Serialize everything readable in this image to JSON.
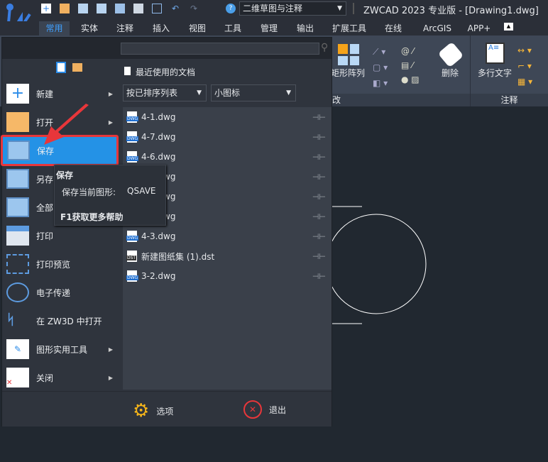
{
  "app": {
    "title": "ZWCAD 2023 专业版 - [Drawing1.dwg]",
    "workspace": "二维草图与注释"
  },
  "quick_access": [
    "new-icon",
    "open-icon",
    "save-icon",
    "save-as-icon",
    "copy-icon",
    "print-icon",
    "preview-icon",
    "undo-icon",
    "redo-icon",
    "help-icon"
  ],
  "tabs": [
    {
      "label": "常用",
      "active": true
    },
    {
      "label": "实体"
    },
    {
      "label": "注释"
    },
    {
      "label": "插入"
    },
    {
      "label": "视图"
    },
    {
      "label": "工具"
    },
    {
      "label": "管理"
    },
    {
      "label": "输出"
    },
    {
      "label": "扩展工具"
    },
    {
      "label": "在线"
    },
    {
      "label": "ArcGIS"
    },
    {
      "label": "APP+"
    }
  ],
  "ribbon": {
    "array_label": "矩形阵列",
    "delete_label": "删除",
    "mtext_label": "多行文字",
    "modify_panel": "改",
    "annotate_panel": "注释"
  },
  "menu": {
    "items": [
      {
        "label": "新建",
        "submenu": true
      },
      {
        "label": "打开",
        "submenu": true
      },
      {
        "label": "保存",
        "highlighted": true
      },
      {
        "label": "另存"
      },
      {
        "label": "全部"
      },
      {
        "label": "打印"
      },
      {
        "label": "打印预览"
      },
      {
        "label": "电子传递"
      },
      {
        "label": "在 ZW3D 中打开"
      },
      {
        "label": "图形实用工具",
        "submenu": true
      },
      {
        "label": "关闭",
        "submenu": true
      }
    ],
    "recent_header": "最近使用的文档",
    "sort_select": "按已排序列表",
    "view_select": "小图标",
    "files": [
      {
        "name": "4-1.dwg",
        "type": "DWG"
      },
      {
        "name": "4-7.dwg",
        "type": "DWG"
      },
      {
        "name": "4-6.dwg",
        "type": "DWG"
      },
      {
        "name": "4-5.dwg",
        "type": "DWG"
      },
      {
        "name": "4-4.dwg",
        "type": "DWG"
      },
      {
        "name": "4-2.dwg",
        "type": "DWG"
      },
      {
        "name": "4-3.dwg",
        "type": "DWG"
      },
      {
        "name": "新建图纸集 (1).dst",
        "type": "DST"
      },
      {
        "name": "3-2.dwg",
        "type": "DWG"
      }
    ],
    "options_label": "选项",
    "exit_label": "退出"
  },
  "tooltip": {
    "title": "保存",
    "desc": "保存当前图形:",
    "command": "QSAVE",
    "help": "F1获取更多帮助"
  },
  "colors": {
    "accent": "#3fa0ff",
    "highlight": "#2492e6",
    "annotation_red": "#e8363a"
  }
}
